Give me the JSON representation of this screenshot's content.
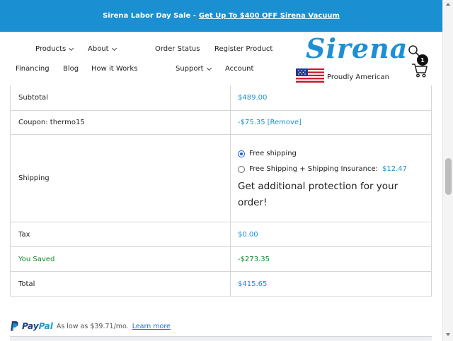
{
  "promo": {
    "text": "Sirena Labor Day Sale -",
    "link": "Get Up To $400 OFF Sirena Vacuum"
  },
  "nav": {
    "products": "Products",
    "about": "About",
    "order_status": "Order Status",
    "register_product": "Register Product",
    "financing": "Financing",
    "blog": "Blog",
    "how_it_works": "How it Works",
    "support": "Support",
    "account": "Account"
  },
  "brand": {
    "logo_text": "Sirena",
    "tagline": "Proudly American"
  },
  "cart": {
    "count": "1"
  },
  "totals": {
    "subtotal_label": "Subtotal",
    "subtotal_value": "$489.00",
    "coupon_label": "Coupon: thermo15",
    "coupon_value": "-$75.35",
    "coupon_remove": "[Remove]",
    "shipping_label": "Shipping",
    "shipping_options": [
      {
        "label": "Free shipping",
        "selected": true
      },
      {
        "label": "Free Shipping + Shipping Insurance:",
        "price": "$12.47",
        "selected": false
      }
    ],
    "protection_text": "Get additional protection for your order!",
    "tax_label": "Tax",
    "tax_value": "$0.00",
    "saved_label": "You Saved",
    "saved_value": "-$273.35",
    "total_label": "Total",
    "total_value": "$415.65"
  },
  "paypal": {
    "logo_pay": "Pay",
    "logo_pal": "Pal",
    "text": "As low as $39.71/mo.",
    "learn_more": "Learn more"
  },
  "colors": {
    "accent": "#1a8fd1",
    "saved": "#0f8a2b",
    "paypal_dark": "#253b80",
    "paypal_light": "#179bd7"
  }
}
